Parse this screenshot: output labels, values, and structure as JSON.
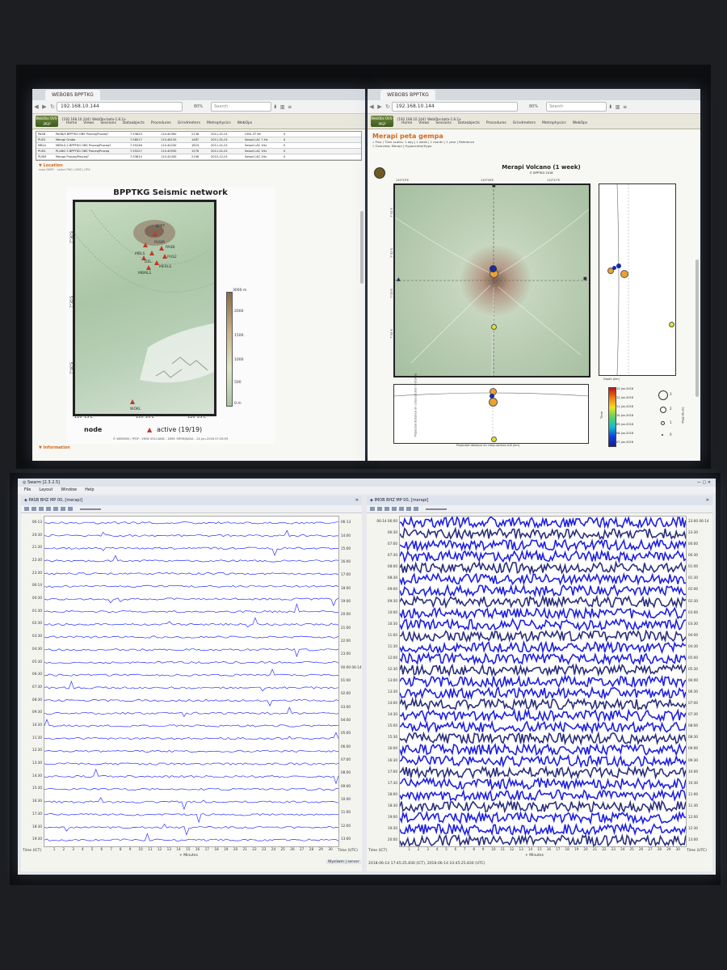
{
  "browser_left": {
    "tab_title": "WEBOBS BPPTKG",
    "url": "192.168.10.144",
    "zoom": "80%",
    "search_placeholder": "Search",
    "webobs_title": "{192.168.10.144} WebObs-beta-1.8.2+",
    "webobs_logo": "WebObs OVS-IPGP",
    "menu": [
      "Home",
      "Views",
      "Sessions",
      "Dataobjects",
      "Procedures",
      "Grindmeters",
      "Metrophysics",
      "WebOps"
    ],
    "table_rows": [
      {
        "code": "PASB",
        "name": "PASB/S BPPTKG OBS Proceq/Proceq?",
        "lat": "7.53620",
        "lon": "110.40390",
        "elev": "2136",
        "date": "2011-01-01",
        "type": "CMG-3T 60",
        "n": "0"
      },
      {
        "code": "PUS2",
        "name": "Merapi Grabe",
        "lat": "7.56017",
        "lon": "110.46130",
        "elev": "1487",
        "date": "2011-01-01",
        "type": "Seisat LAC 7-Hz",
        "n": "0"
      },
      {
        "code": "MBLS",
        "name": "MERLS-2 BPPTKG OBS Proceq/Proceq?",
        "lat": "7.55246",
        "lon": "110.40230",
        "elev": "1823",
        "date": "2011-01-01",
        "type": "Seisat LAC 1Hz",
        "n": "0"
      },
      {
        "code": "PUSS",
        "name": "PLANG S BPPTKG OBS Proceq/Proceq",
        "lat": "7.55227",
        "lon": "110.40930",
        "elev": "1576",
        "date": "2011-01-01",
        "type": "Seisat LAC 1Hz",
        "n": "0"
      },
      {
        "code": "PUSM",
        "name": "Merapi Proceq/Proceq?",
        "lat": "7.53810",
        "lon": "110.42430",
        "elev": "2156",
        "date": "2015-12-01",
        "type": "Seisat LAC 1Hz",
        "n": "0"
      }
    ],
    "location_header": "Location",
    "location_sub": "rows NMPC  ·  select  PNG  |  KMZ  |  GPX",
    "map_title": "BPPTKG Seismic network",
    "map_labels": [
      "BPPT",
      "PUSM",
      "PASB",
      "MBLS",
      "PUS2",
      "DEL",
      "MERLS",
      "MBMLS",
      "WOKL"
    ],
    "axis_lat": [
      "7°30'S",
      "7°35'S",
      "7°40'S"
    ],
    "axis_lon": [
      "110°15'E",
      "110°20'E",
      "110°25'E"
    ],
    "colorbar_label": "3000 m",
    "colorbar_ticks": [
      "2000",
      "1500",
      "1000",
      "500",
      "0 m"
    ],
    "legend_node": "node",
    "legend_active": "active (19/19)",
    "footer": "© WEBOBS / IPGP - VIEW VOLCANIC - DEM: SRTM/NASA - 14-Jun-2018 07:26:59",
    "information_header": "Information"
  },
  "browser_right": {
    "tab_title": "WEBOBS BPPTKG",
    "url": "192.168.10.144",
    "zoom": "80%",
    "search_placeholder": "Search",
    "webobs_title": "{192.168.10.144} WebObs-beta-1.8.2+",
    "webobs_logo": "WebObs OVS-IPGP",
    "menu": [
      "Home",
      "Views",
      "Sessions",
      "Dataobjects",
      "Procedures",
      "Grindmeters",
      "Metrophysics",
      "WebOps"
    ],
    "page_title": "Merapi peta gempa",
    "timescale": "» Proc / Time scales: 1 day | 1 week | 1 month | 1 year | Reference",
    "summary": "» Overview: Merapi | Hypocentre/Hypo",
    "plot_title": "Merapi Volcano (1 week)",
    "plot_subtitle": "© BPPTKG 2018",
    "top_ticks": [
      "110°25'E",
      "110°26'E",
      "110°27'E"
    ],
    "left_ticks": [
      "7°31'S",
      "7°32'S",
      "7°33'S",
      "7°34'S"
    ],
    "depth_label": "Depth (km)",
    "xsection_label": "Projected distance on cross-section A-B (km)",
    "xsection_label2": "Projected distance on cross-section C-D (km)",
    "time_ticks": [
      "13-Jun-2018",
      "12-Jun-2018",
      "11-Jun-2018",
      "10-Jun-2018",
      "09-Jun-2018",
      "08-Jun-2018",
      "07-Jun-2018"
    ],
    "time_label": "Time",
    "magnitude_label": "Magnitude",
    "magnitudes": [
      "3",
      "2",
      "1",
      "0"
    ]
  },
  "swarm": {
    "app_title": "Swarm [2.3.2.5]",
    "menu": [
      "File",
      "Layout",
      "Window",
      "Help"
    ],
    "left": {
      "title": "PASB BHZ MP 00, [merapi]",
      "left_times": [
        "06-13",
        "20:30",
        "21:30",
        "22:30",
        "23:30",
        "06-14",
        "00:30",
        "01:30",
        "02:30",
        "03:30",
        "04:30",
        "05:30",
        "06:30",
        "07:30",
        "08:30",
        "09:30",
        "10:30",
        "11:30",
        "12:30",
        "13:30",
        "14:30",
        "15:30",
        "16:30",
        "17:30",
        "18:30",
        "19:30"
      ],
      "right_times": [
        "06-13",
        "14:00",
        "15:00",
        "16:00",
        "17:00",
        "18:00",
        "19:00",
        "20:00",
        "21:00",
        "22:00",
        "23:00",
        "00:00 06-14",
        "01:00",
        "02:00",
        "03:00",
        "04:00",
        "05:00",
        "06:00",
        "07:00",
        "08:00",
        "09:00",
        "10:00",
        "11:00",
        "12:00",
        "13:00"
      ],
      "x_ticks": [
        "1",
        "2",
        "3",
        "4",
        "5",
        "6",
        "7",
        "8",
        "9",
        "10",
        "11",
        "12",
        "13",
        "14",
        "15",
        "16",
        "17",
        "18",
        "19",
        "20",
        "21",
        "22",
        "23",
        "24",
        "25",
        "26",
        "27",
        "28",
        "29",
        "30"
      ],
      "x_label": "+ Minutes",
      "time_left": "Time (ICT)",
      "time_right": "Time (UTC)",
      "status": "Wysliwm | server"
    },
    "right": {
      "title": "IMOB BHZ MP 00, [merapi]",
      "left_times": [
        "06-14 06:00",
        "06:30",
        "07:00",
        "07:30",
        "08:00",
        "08:30",
        "09:00",
        "09:30",
        "10:00",
        "10:30",
        "11:00",
        "11:30",
        "12:00",
        "12:30",
        "13:00",
        "13:30",
        "14:00",
        "14:30",
        "15:00",
        "15:30",
        "16:00",
        "16:30",
        "17:00",
        "17:30",
        "18:00",
        "18:30",
        "19:00",
        "19:30",
        "20:00"
      ],
      "right_times": [
        "23:00 06-14",
        "23:30",
        "00:00",
        "00:30",
        "01:00",
        "01:30",
        "02:00",
        "02:30",
        "03:00",
        "03:30",
        "04:00",
        "04:30",
        "05:00",
        "05:30",
        "06:00",
        "06:30",
        "07:00",
        "07:30",
        "08:00",
        "08:30",
        "09:00",
        "09:30",
        "10:00",
        "10:30",
        "11:00",
        "11:30",
        "12:00",
        "12:30",
        "13:00"
      ],
      "x_ticks": [
        "1",
        "2",
        "3",
        "4",
        "5",
        "6",
        "7",
        "8",
        "9",
        "10",
        "11",
        "12",
        "13",
        "14",
        "15",
        "16",
        "17",
        "18",
        "19",
        "20",
        "21",
        "22",
        "23",
        "24",
        "25",
        "26",
        "27",
        "28",
        "29",
        "30"
      ],
      "x_label": "+ Minutes",
      "time_left": "Time (ICT)",
      "time_right": "Time (UTC)",
      "status": "2018-06-14 17:45:25.830 (ICT), 2018-06-14 10:45:25.830 (UTC)"
    }
  },
  "colors": {
    "trace": "#2b34ff",
    "trace_dense": "#1f20e0",
    "dark_trace": "#2b2f7a",
    "orange": "#f0a030",
    "quake_blue": "#1a2aa8"
  }
}
